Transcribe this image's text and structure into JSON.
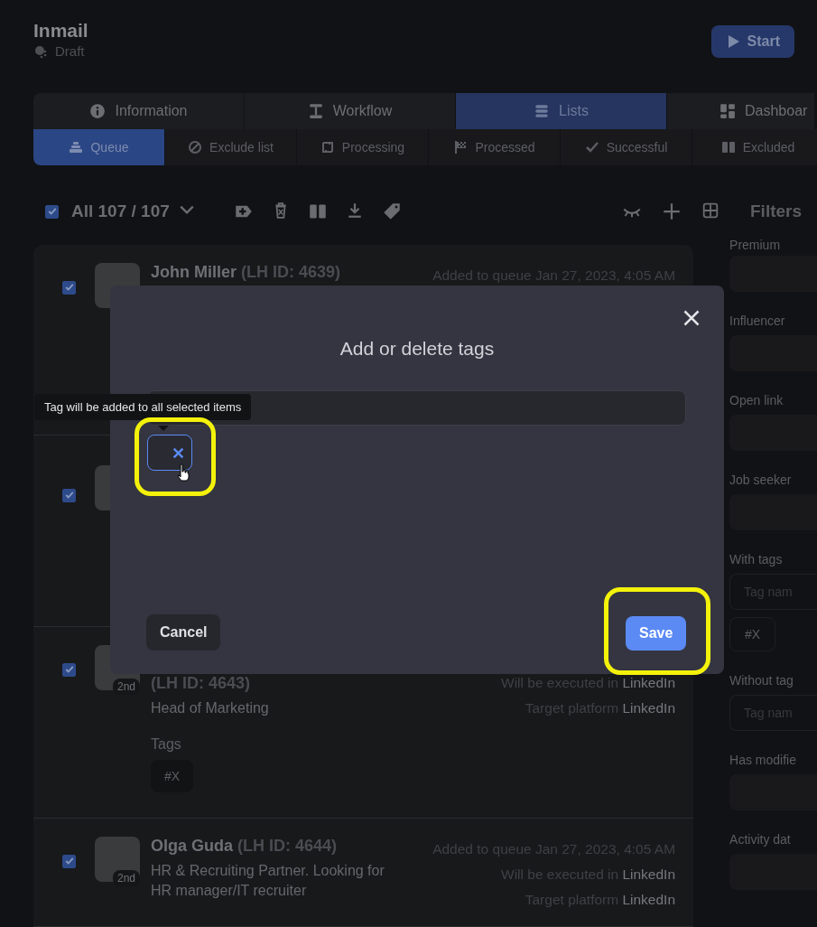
{
  "header": {
    "title": "Inmail",
    "status": "Draft",
    "start_button": "Start"
  },
  "tabs": [
    {
      "label": "Information",
      "selected": false
    },
    {
      "label": "Workflow",
      "selected": false
    },
    {
      "label": "Lists",
      "selected": true
    },
    {
      "label": "Dashboar",
      "selected": false
    }
  ],
  "subtabs": [
    {
      "label": "Queue",
      "selected": true
    },
    {
      "label": "Exclude list",
      "selected": false
    },
    {
      "label": "Processing",
      "selected": false
    },
    {
      "label": "Processed",
      "selected": false
    },
    {
      "label": "Successful",
      "selected": false
    },
    {
      "label": "Excluded",
      "selected": false
    }
  ],
  "toolbar": {
    "select_all_checked": true,
    "count": "All 107 / 107"
  },
  "rows": [
    {
      "checked": true,
      "name": "John Miller",
      "lh_id": "(LH ID: 4639)",
      "added": "Added to queue Jan 27, 2023, 4:05 AM"
    },
    {
      "checked": true
    },
    {
      "checked": true,
      "degree": "2nd",
      "lh_id": "(LH ID: 4643)",
      "headline": "Head of Marketing",
      "meta": [
        {
          "label": "Will be executed in",
          "value": "LinkedIn"
        },
        {
          "label": "Target platform",
          "value": "LinkedIn"
        }
      ],
      "tags_label": "Tags",
      "tags": [
        "#X"
      ]
    },
    {
      "checked": true,
      "degree": "2nd",
      "name": "Olga Guda",
      "lh_id": "(LH ID: 4644)",
      "added": "Added to queue Jan 27, 2023, 4:05 AM",
      "headline": "HR & Recruiting Partner. Looking for HR manager/IT recruiter",
      "meta": [
        {
          "label": "Will be executed in",
          "value": "LinkedIn"
        },
        {
          "label": "Target platform",
          "value": "LinkedIn"
        }
      ]
    }
  ],
  "filters": {
    "title": "Filters",
    "items": [
      {
        "kind": "select",
        "label": "Premium"
      },
      {
        "kind": "select",
        "label": "Influencer"
      },
      {
        "kind": "select",
        "label": "Open link"
      },
      {
        "kind": "select",
        "label": "Job seeker"
      },
      {
        "kind": "tags",
        "label": "With tags",
        "placeholder": "Tag nam",
        "tags": [
          "#X"
        ]
      },
      {
        "kind": "tags",
        "label": "Without tag",
        "placeholder": "Tag nam"
      },
      {
        "kind": "select",
        "label": "Has modifie"
      },
      {
        "kind": "select",
        "label": "Activity dat"
      }
    ]
  },
  "modal": {
    "title": "Add or delete tags",
    "tooltip": "Tag will be added to all selected items",
    "new_tags": [
      {
        "hovered": true
      }
    ],
    "cancel_button": "Cancel",
    "save_button": "Save"
  }
}
